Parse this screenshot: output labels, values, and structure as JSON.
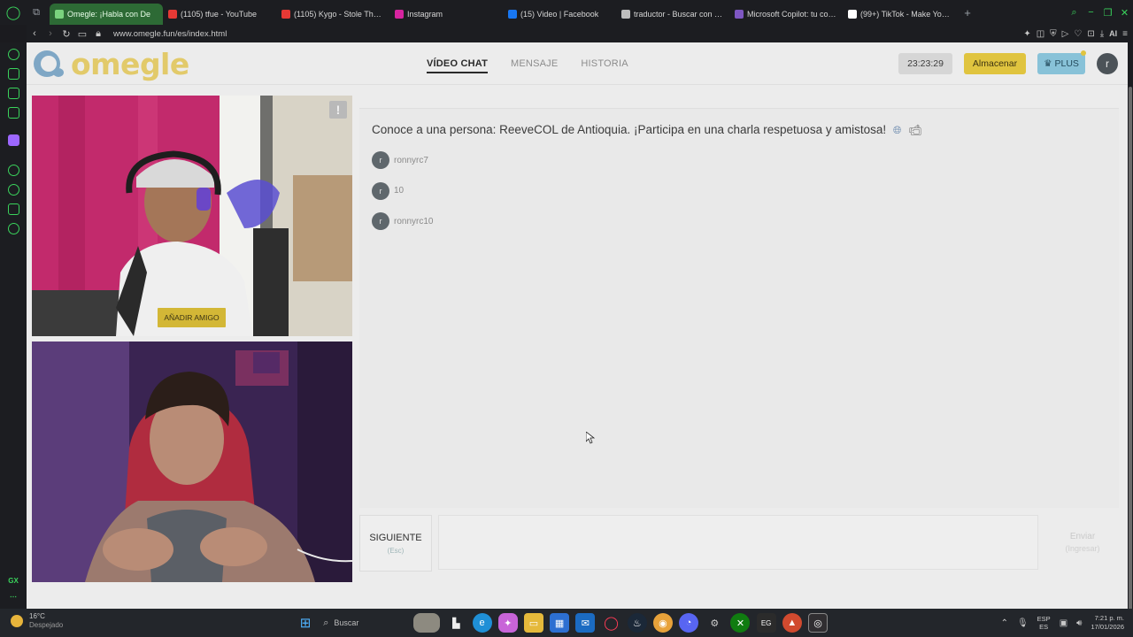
{
  "browser": {
    "tabs": [
      {
        "title": "Omegle: ¡Habla con De",
        "color": "#7ad37e",
        "active": true
      },
      {
        "title": "(1105) tfue - YouTube",
        "color": "#e53935"
      },
      {
        "title": "(1105) Kygo - Stole The Sh",
        "color": "#e53935"
      },
      {
        "title": "Instagram",
        "color": "#d6249f"
      },
      {
        "title": "(15) Video | Facebook",
        "color": "#1877f2"
      },
      {
        "title": "traductor - Buscar con Go",
        "color": "#bdbdbd"
      },
      {
        "title": "Microsoft Copilot: tu comp",
        "color": "#7e57c2"
      },
      {
        "title": "(99+) TikTok - Make Your D",
        "color": "#ffffff"
      }
    ],
    "url": "www.omegle.fun/es/index.html",
    "ai_label": "AI"
  },
  "site": {
    "logo_text": "omegle",
    "nav": [
      {
        "label": "VÍDEO CHAT",
        "active": true
      },
      {
        "label": "MENSAJE"
      },
      {
        "label": "HISTORIA"
      }
    ],
    "timer": "23:23:29",
    "save_label": "Almacenar",
    "plus_label": "PLUS",
    "user_initial": "r"
  },
  "video": {
    "report_label": "!",
    "add_friend_label": "AÑADIR AMIGO"
  },
  "chat": {
    "intro": "Conoce a una persona: ReeveCOL de Antioquia. ¡Participa en una charla respetuosa y amistosa!",
    "messages": [
      {
        "initial": "r",
        "text": "ronnyrc7"
      },
      {
        "initial": "r",
        "text": "10"
      },
      {
        "initial": "r",
        "text": "ronnyrc10"
      }
    ],
    "next_label": "SIGUIENTE",
    "next_hint": "(Esc)",
    "input_value": "",
    "send_label": "Enviar",
    "send_hint": "(Ingresar)"
  },
  "taskbar": {
    "temp": "16°C",
    "weather": "Despejado",
    "search_placeholder": "Buscar",
    "lang_top": "ESP",
    "lang_bottom": "ES",
    "time": "7:21 p. m.",
    "date": "17/01/2026"
  }
}
